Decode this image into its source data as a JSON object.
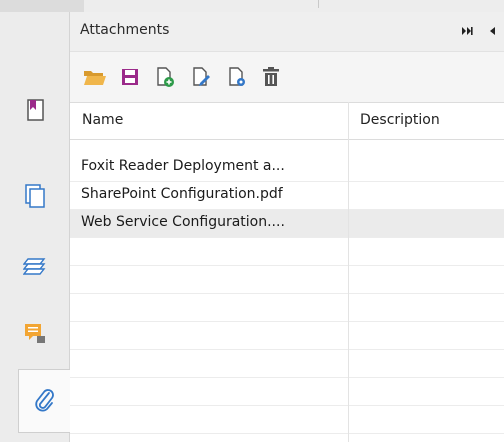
{
  "panel": {
    "title": "Attachments"
  },
  "table": {
    "headers": {
      "name": "Name",
      "description": "Description"
    },
    "rows": [
      {
        "name": "Foxit Reader Deployment a...",
        "description": "",
        "selected": false
      },
      {
        "name": "SharePoint Configuration.pdf",
        "description": "",
        "selected": false
      },
      {
        "name": "Web Service Configuration....",
        "description": "",
        "selected": true
      }
    ]
  },
  "icons": {
    "sidebar": [
      "bookmark-icon",
      "pages-icon",
      "layers-icon",
      "comments-icon",
      "attachments-icon"
    ],
    "toolbar": [
      "open-folder-icon",
      "save-icon",
      "add-file-icon",
      "edit-file-icon",
      "file-settings-icon",
      "delete-icon"
    ],
    "header": [
      "expand-icon",
      "collapse-icon"
    ]
  },
  "colors": {
    "folder": "#f0b64b",
    "purple": "#9b2a8a",
    "green": "#2e9b4a",
    "blue": "#3478c8",
    "gray": "#555555",
    "comment": "#f2a533"
  }
}
